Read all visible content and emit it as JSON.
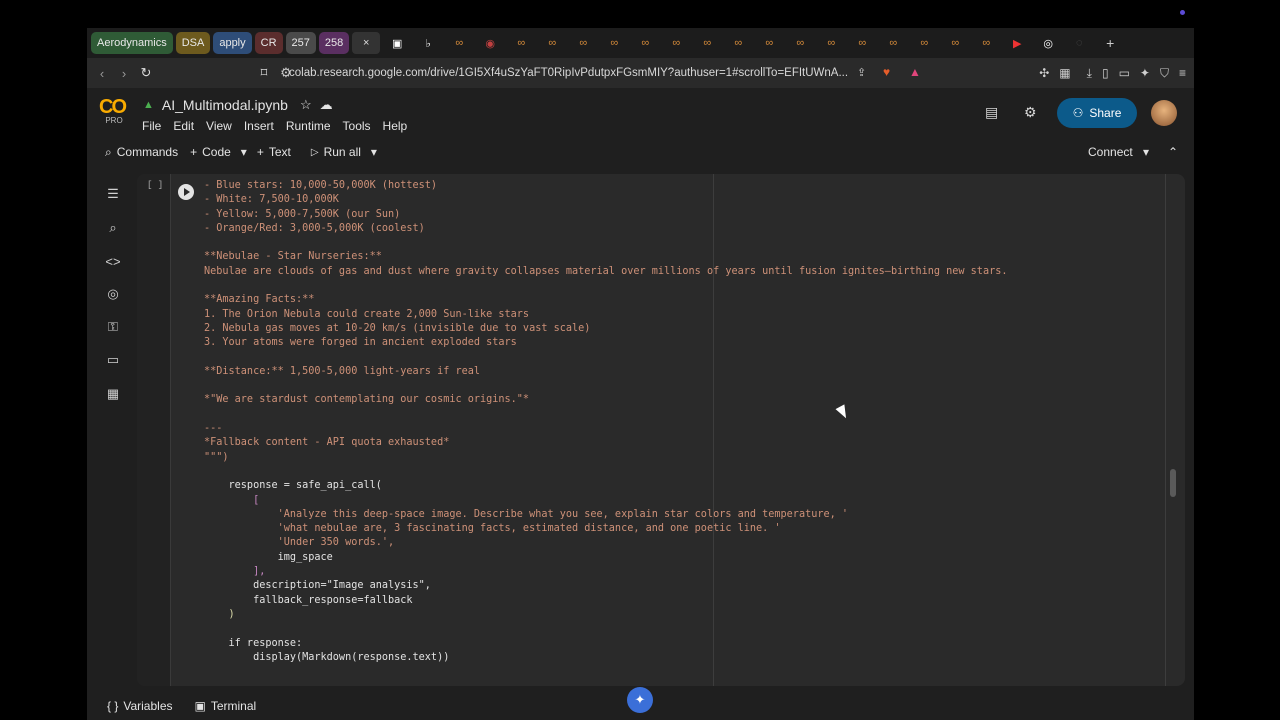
{
  "browser": {
    "tabs": [
      {
        "label": "Aerodynamics",
        "color": "#2f5b36"
      },
      {
        "label": "DSA",
        "color": "#6d5a1e"
      },
      {
        "label": "apply",
        "color": "#2e4d78"
      },
      {
        "label": "CR",
        "color": "#5b2d2d"
      },
      {
        "label": "257",
        "color": "#4a4a4a"
      },
      {
        "label": "258",
        "color": "#5a2f61"
      }
    ],
    "close_glyph": "×",
    "new_tab_glyph": "+",
    "url": "colab.research.google.com/drive/1GI5Xf4uSzYaFT0RipIvPdutpxFGsmMIY?authuser=1#scrollTo=EFItUWnA..."
  },
  "colab": {
    "logo": "CO",
    "plan": "PRO",
    "notebook_title": "AI_Multimodal.ipynb",
    "menu": [
      "File",
      "Edit",
      "View",
      "Insert",
      "Runtime",
      "Tools",
      "Help"
    ],
    "share_label": "Share",
    "toolbar": {
      "commands": "Commands",
      "code": "Code",
      "text": "Text",
      "run_all": "Run all",
      "connect": "Connect"
    },
    "cell_bracket": "[ ]"
  },
  "code_lines": [
    {
      "t": "- Blue stars: 10,000-50,000K (hottest)",
      "c": "s"
    },
    {
      "t": "- White: 7,500-10,000K",
      "c": "s"
    },
    {
      "t": "- Yellow: 5,000-7,500K (our Sun)",
      "c": "s"
    },
    {
      "t": "- Orange/Red: 3,000-5,000K (coolest)",
      "c": "s"
    },
    {
      "t": "",
      "c": "s"
    },
    {
      "t": "**Nebulae - Star Nurseries:**",
      "c": "s"
    },
    {
      "t": "Nebulae are clouds of gas and dust where gravity collapses material over millions of years until fusion ignites—birthing new stars.",
      "c": "s"
    },
    {
      "t": "",
      "c": "s"
    },
    {
      "t": "**Amazing Facts:**",
      "c": "s"
    },
    {
      "t": "1. The Orion Nebula could create 2,000 Sun-like stars",
      "c": "s"
    },
    {
      "t": "2. Nebula gas moves at 10-20 km/s (invisible due to vast scale)",
      "c": "s"
    },
    {
      "t": "3. Your atoms were forged in ancient exploded stars",
      "c": "s"
    },
    {
      "t": "",
      "c": "s"
    },
    {
      "t": "**Distance:** 1,500-5,000 light-years if real",
      "c": "s"
    },
    {
      "t": "",
      "c": "s"
    },
    {
      "t": "*\"We are stardust contemplating our cosmic origins.\"*",
      "c": "s"
    },
    {
      "t": "",
      "c": "s"
    },
    {
      "t": "---",
      "c": "s"
    },
    {
      "t": "*Fallback content - API quota exhausted*",
      "c": "s"
    },
    {
      "t": "\"\"\")",
      "c": "s"
    },
    {
      "t": "",
      "c": ""
    },
    {
      "t": "    response = safe_api_call(",
      "c": ""
    },
    {
      "t": "        [",
      "c": "p"
    },
    {
      "t": "            'Analyze this deep-space image. Describe what you see, explain star colors and temperature, '",
      "c": "s"
    },
    {
      "t": "            'what nebulae are, 3 fascinating facts, estimated distance, and one poetic line. '",
      "c": "s"
    },
    {
      "t": "            'Under 350 words.',",
      "c": "s"
    },
    {
      "t": "            img_space",
      "c": ""
    },
    {
      "t": "        ],",
      "c": "p"
    },
    {
      "t": "        description=\"Image analysis\",",
      "c": ""
    },
    {
      "t": "        fallback_response=fallback",
      "c": ""
    },
    {
      "t": "    )",
      "c": "b"
    },
    {
      "t": "",
      "c": ""
    },
    {
      "t": "    if response:",
      "c": ""
    },
    {
      "t": "        display(Markdown(response.text))",
      "c": ""
    }
  ],
  "status": {
    "variables": "Variables",
    "terminal": "Terminal"
  }
}
